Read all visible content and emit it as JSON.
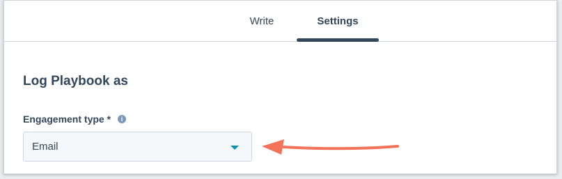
{
  "tabs": [
    {
      "label": "Write",
      "active": false
    },
    {
      "label": "Settings",
      "active": true
    }
  ],
  "section": {
    "title": "Log Playbook as"
  },
  "engagement_field": {
    "label": "Engagement type *",
    "info_icon": "info-icon",
    "value": "Email",
    "caret_icon": "caret-down-icon"
  },
  "colors": {
    "text": "#33475b",
    "accent": "#0091ae",
    "arrow": "#f2735a",
    "field_bg": "#f5f8fa"
  }
}
